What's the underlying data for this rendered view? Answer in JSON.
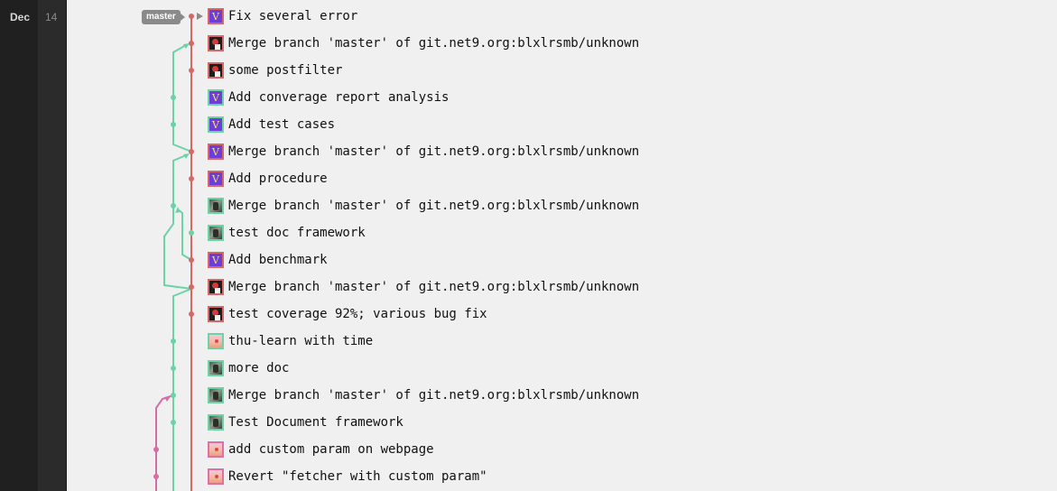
{
  "date": {
    "month": "Dec",
    "day": "14"
  },
  "ref_tag": "master",
  "commits": [
    {
      "message": "Fix several error",
      "avatar": "letter-v-avatar",
      "letter": "V",
      "border": "#d66767"
    },
    {
      "message": "Merge branch 'master' of git.net9.org:blxlrsmb/unknown",
      "avatar": "dark-avatar",
      "border": "#d66767"
    },
    {
      "message": "some postfilter",
      "avatar": "dark-avatar",
      "border": "#d66767"
    },
    {
      "message": "Add converage report analysis",
      "avatar": "letter-v-avatar",
      "letter": "V",
      "border": "#6cd3a8"
    },
    {
      "message": "Add test cases",
      "avatar": "letter-v-avatar",
      "letter": "V",
      "border": "#6cd3a8"
    },
    {
      "message": "Merge branch 'master' of git.net9.org:blxlrsmb/unknown",
      "avatar": "letter-v-avatar",
      "letter": "V",
      "border": "#d66767"
    },
    {
      "message": "Add procedure",
      "avatar": "letter-v-avatar",
      "letter": "V",
      "border": "#d66767"
    },
    {
      "message": "Merge branch 'master' of git.net9.org:blxlrsmb/unknown",
      "avatar": "photo-avatar",
      "border": "#6cd3a8"
    },
    {
      "message": "test doc framework",
      "avatar": "photo-avatar",
      "border": "#6cd3a8"
    },
    {
      "message": "Add benchmark",
      "avatar": "letter-v-avatar",
      "letter": "V",
      "border": "#d66767"
    },
    {
      "message": "Merge branch 'master' of git.net9.org:blxlrsmb/unknown",
      "avatar": "dark-avatar",
      "border": "#d66767"
    },
    {
      "message": "test coverage 92%; various bug fix",
      "avatar": "dark-avatar",
      "border": "#d66767"
    },
    {
      "message": "thu-learn with time",
      "avatar": "sunset-avatar",
      "border": "#6cd3a8"
    },
    {
      "message": "more doc",
      "avatar": "photo-avatar",
      "border": "#6cd3a8"
    },
    {
      "message": "Merge branch 'master' of git.net9.org:blxlrsmb/unknown",
      "avatar": "photo-avatar",
      "border": "#6cd3a8"
    },
    {
      "message": "Test Document framework",
      "avatar": "photo-avatar",
      "border": "#6cd3a8"
    },
    {
      "message": "add custom param on webpage",
      "avatar": "sunset-avatar",
      "border": "#e06fa6"
    },
    {
      "message": "Revert \"fetcher with custom param\"",
      "avatar": "sunset-avatar",
      "border": "#e06fa6"
    }
  ],
  "colors": {
    "red_branch": "#d66767",
    "green_branch": "#6cd3a8",
    "pink_branch": "#d46fa5"
  }
}
